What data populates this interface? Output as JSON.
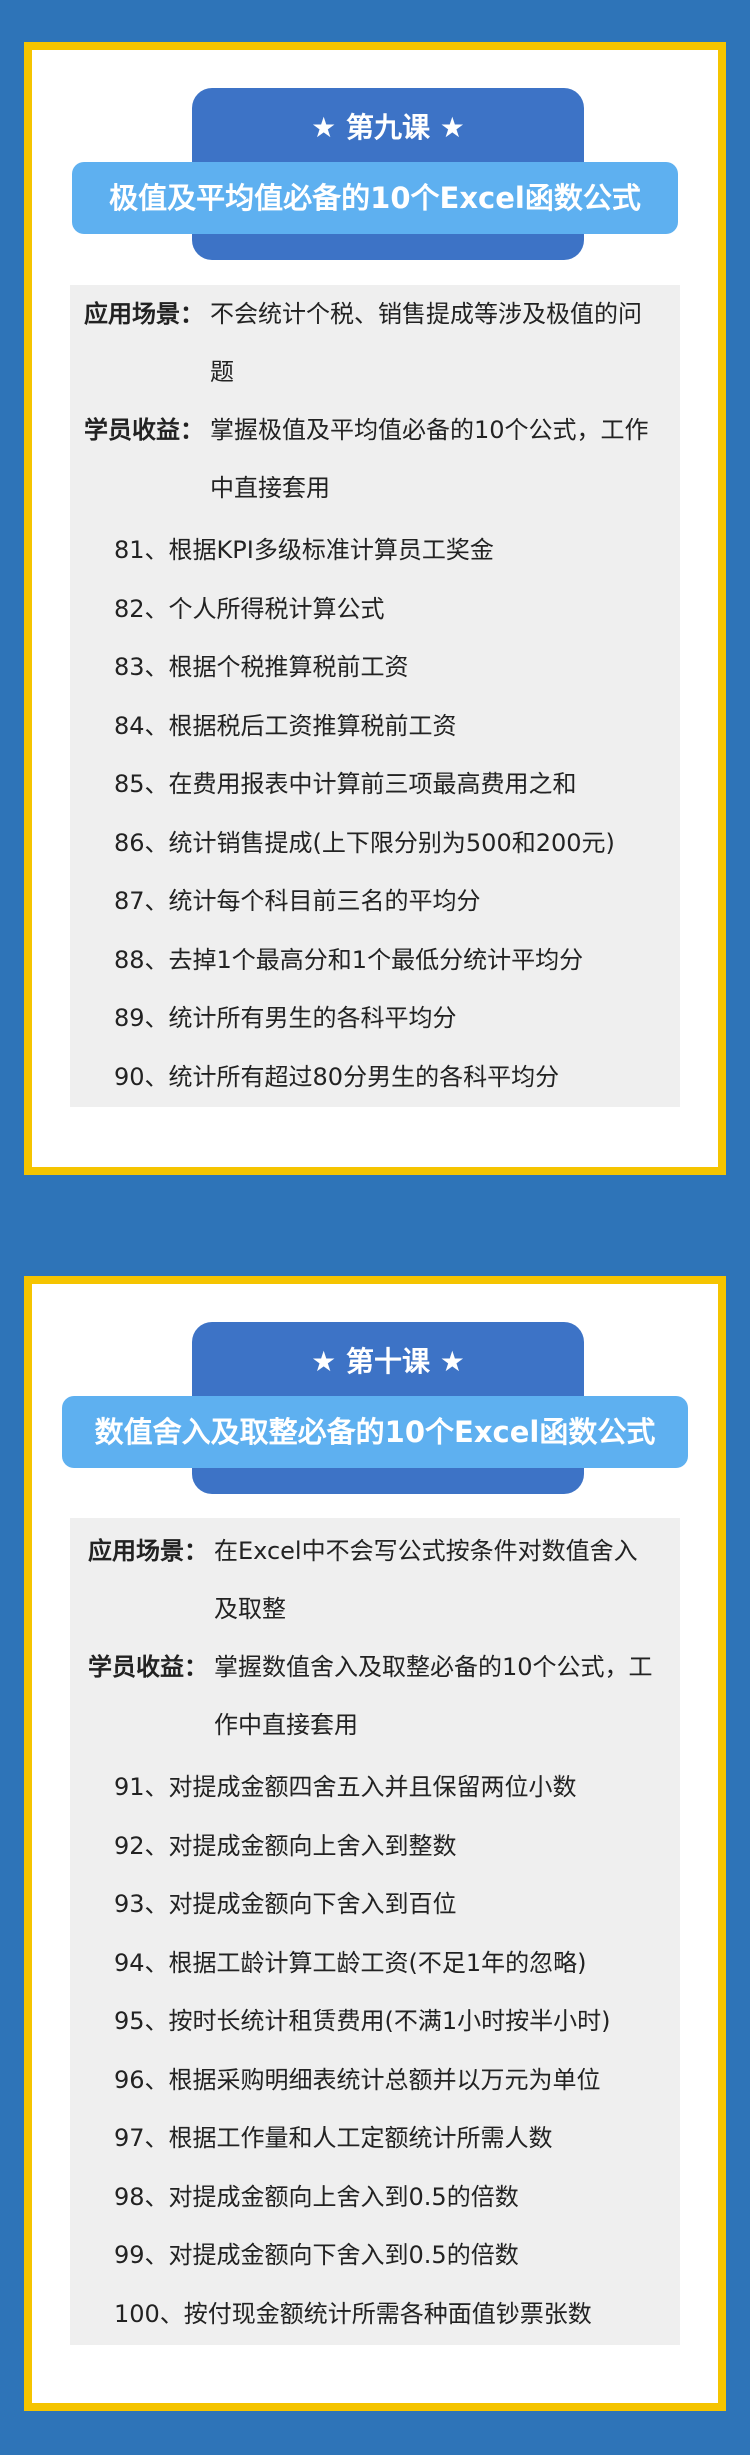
{
  "lessons": [
    {
      "label": "★ 第九课 ★",
      "title": "极值及平均值必备的10个Excel函数公式",
      "scenario_key": "应用场景：",
      "scenario_val": "不会统计个税、销售提成等涉及极值的问题",
      "gain_key": "学员收益：",
      "gain_val": "掌握极值及平均值必备的10个公式，工作中直接套用",
      "items": [
        "81、根据KPI多级标准计算员工奖金",
        "82、个人所得税计算公式",
        "83、根据个税推算税前工资",
        "84、根据税后工资推算税前工资",
        "85、在费用报表中计算前三项最高费用之和",
        "86、统计销售提成(上下限分别为500和200元)",
        "87、统计每个科目前三名的平均分",
        "88、去掉1个最高分和1个最低分统计平均分",
        "89、统计所有男生的各科平均分",
        "90、统计所有超过80分男生的各科平均分"
      ]
    },
    {
      "label": "★ 第十课 ★",
      "title": "数值舍入及取整必备的10个Excel函数公式",
      "scenario_key": "应用场景：",
      "scenario_val": "在Excel中不会写公式按条件对数值舍入及取整",
      "gain_key": "学员收益：",
      "gain_val": "掌握数值舍入及取整必备的10个公式，工作中直接套用",
      "items": [
        "91、对提成金额四舍五入并且保留两位小数",
        "92、对提成金额向上舍入到整数",
        "93、对提成金额向下舍入到百位",
        "94、根据工龄计算工龄工资(不足1年的忽略)",
        "95、按时长统计租赁费用(不满1小时按半小时)",
        "96、根据采购明细表统计总额并以万元为单位",
        "97、根据工作量和人工定额统计所需人数",
        "98、对提成金额向上舍入到0.5的倍数",
        "99、对提成金额向下舍入到0.5的倍数",
        "100、按付现金额统计所需各种面值钞票张数"
      ]
    }
  ]
}
